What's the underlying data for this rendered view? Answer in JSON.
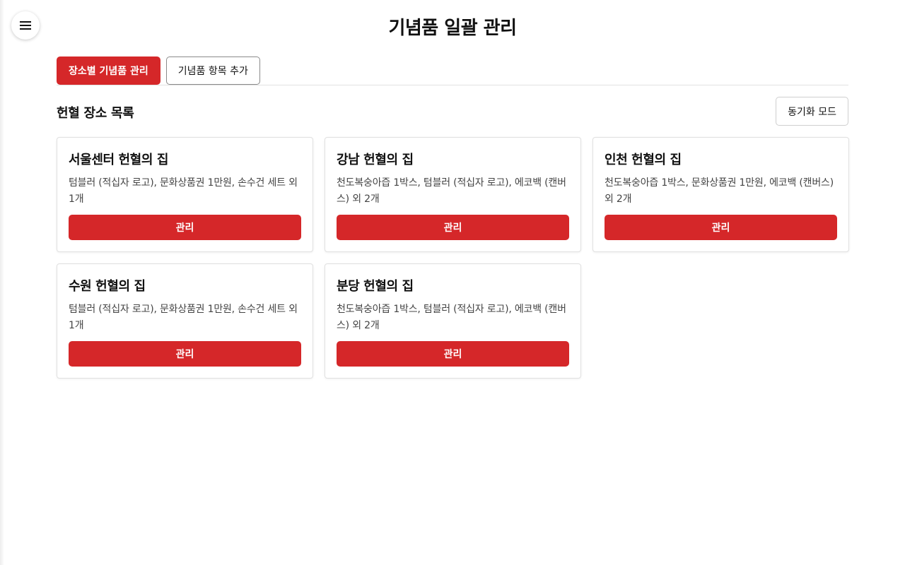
{
  "header": {
    "menu_icon": "hamburger-menu-icon",
    "title": "기념품 일괄 관리"
  },
  "tabs": [
    {
      "label": "장소별 기념품 관리",
      "active": true
    },
    {
      "label": "기념품 항목 추가",
      "active": false
    }
  ],
  "section": {
    "title": "헌혈 장소 목록",
    "sync_label": "동기화 모드"
  },
  "locations": [
    {
      "name": "서울센터 헌혈의 집",
      "items": "텀블러 (적십자 로고), 문화상품권 1만원, 손수건 세트 외 1개",
      "button": "관리"
    },
    {
      "name": "강남 헌혈의 집",
      "items": "천도복숭아즙 1박스, 텀블러 (적십자 로고), 에코백 (캔버스) 외 2개",
      "button": "관리"
    },
    {
      "name": "인천 헌혈의 집",
      "items": "천도복숭아즙 1박스, 문화상품권 1만원, 에코백 (캔버스) 외 2개",
      "button": "관리"
    },
    {
      "name": "수원 헌혈의 집",
      "items": "텀블러 (적십자 로고), 문화상품권 1만원, 손수건 세트 외 1개",
      "button": "관리"
    },
    {
      "name": "분당 헌혈의 집",
      "items": "천도복숭아즙 1박스, 텀블러 (적십자 로고), 에코백 (캔버스) 외 2개",
      "button": "관리"
    }
  ],
  "colors": {
    "accent": "#d52729",
    "border": "#e0e0e0",
    "text": "#111111",
    "muted_text": "#444444"
  }
}
